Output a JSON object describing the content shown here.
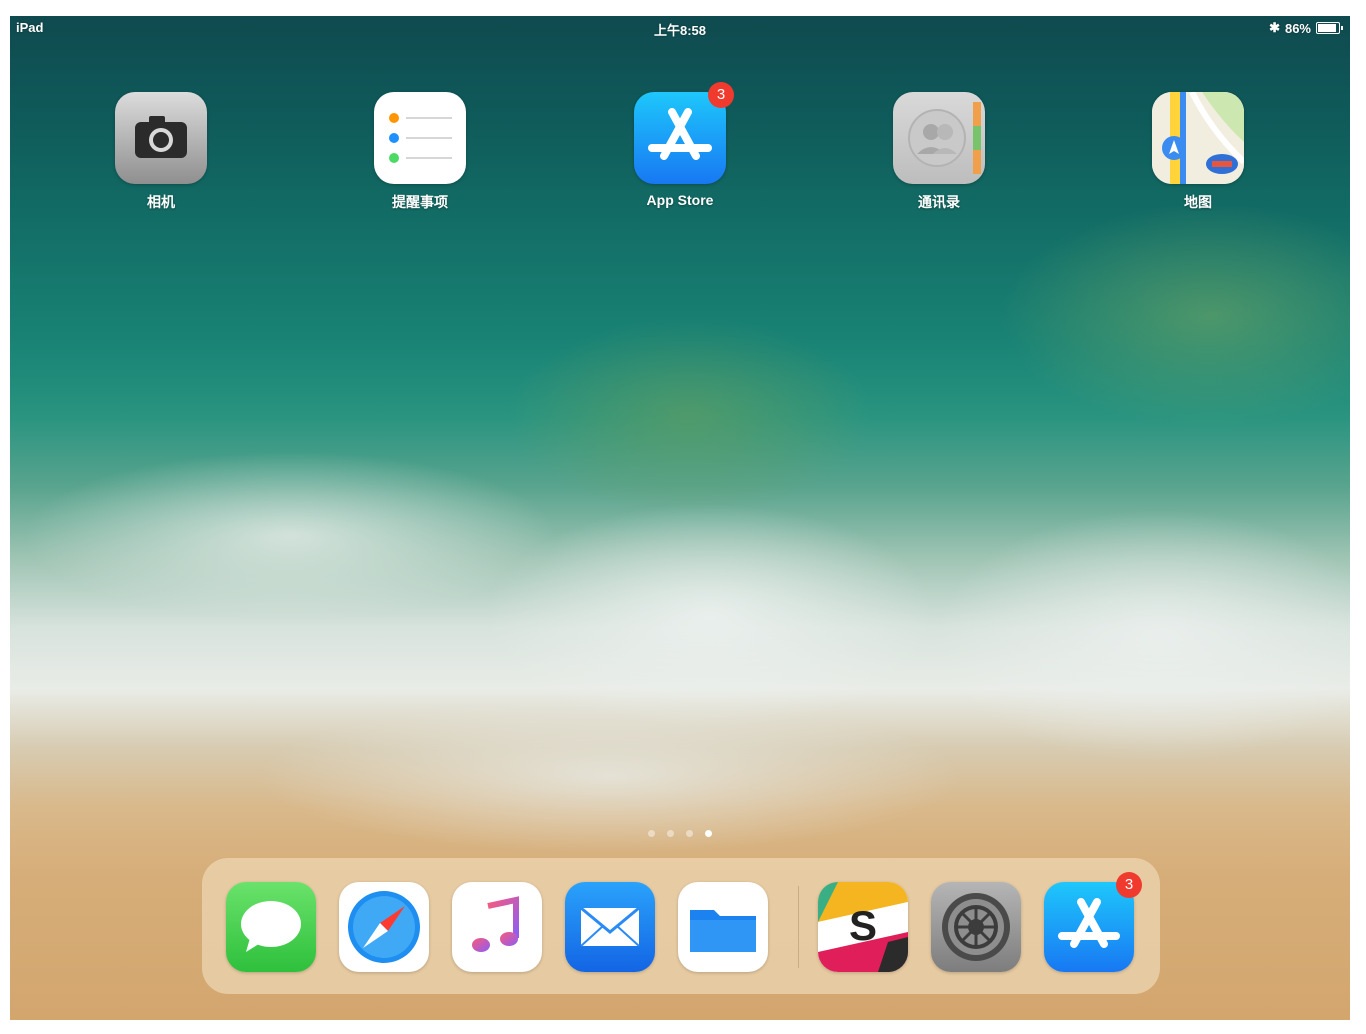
{
  "status_bar": {
    "device": "iPad",
    "time": "上午8:58",
    "battery": "86%"
  },
  "home_apps": [
    {
      "label": "相机",
      "icon": "camera-icon"
    },
    {
      "label": "提醒事项",
      "icon": "reminders-icon"
    },
    {
      "label": "App Store",
      "icon": "app-store-icon",
      "badge": "3"
    },
    {
      "label": "通讯录",
      "icon": "contacts-icon"
    },
    {
      "label": "地图",
      "icon": "maps-icon"
    }
  ],
  "page_indicator": {
    "pages": 4,
    "current": 4
  },
  "dock": {
    "apps": [
      {
        "icon": "messages-icon"
      },
      {
        "icon": "safari-icon"
      },
      {
        "icon": "music-icon"
      },
      {
        "icon": "mail-icon"
      },
      {
        "icon": "files-icon"
      },
      {
        "icon": "slack-icon"
      },
      {
        "icon": "settings-icon"
      },
      {
        "icon": "app-store-icon",
        "badge": "3"
      }
    ]
  },
  "colors": {
    "badge": "#f03a2e",
    "app_store_blue": "#1878f3"
  }
}
